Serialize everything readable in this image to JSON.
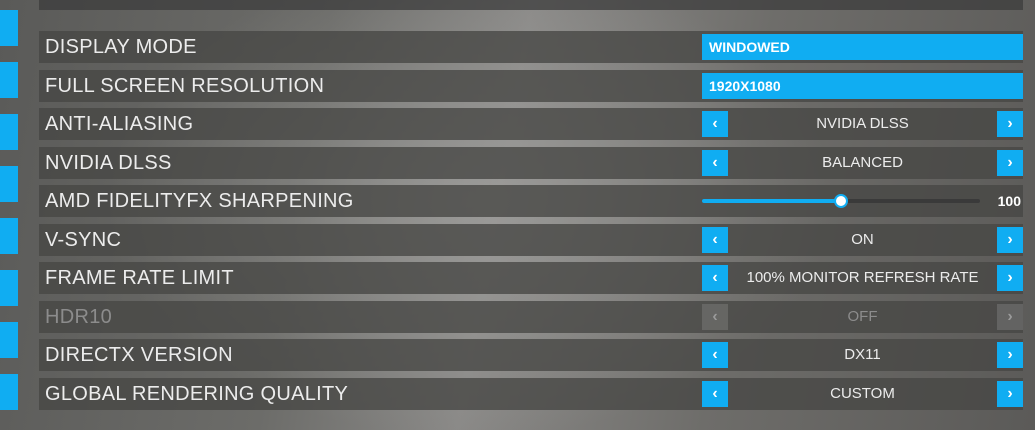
{
  "theme": {
    "accent": "#10adf2",
    "row_background": "#464644"
  },
  "settings": [
    {
      "label": "DISPLAY MODE",
      "control": "dropdown",
      "value": "WINDOWED"
    },
    {
      "label": "FULL SCREEN RESOLUTION",
      "control": "dropdown",
      "value": "1920X1080"
    },
    {
      "label": "ANTI-ALIASING",
      "control": "stepper",
      "value": "NVIDIA DLSS"
    },
    {
      "label": "NVIDIA DLSS",
      "control": "stepper",
      "value": "BALANCED"
    },
    {
      "label": "AMD FIDELITYFX SHARPENING",
      "control": "slider",
      "value": "100",
      "slider_fraction": 0.5
    },
    {
      "label": "V-SYNC",
      "control": "stepper",
      "value": "ON"
    },
    {
      "label": "FRAME RATE LIMIT",
      "control": "stepper",
      "value": "100% MONITOR REFRESH RATE"
    },
    {
      "label": "HDR10",
      "control": "stepper",
      "value": "OFF",
      "disabled": true
    },
    {
      "label": "DIRECTX VERSION",
      "control": "stepper",
      "value": "DX11"
    },
    {
      "label": "GLOBAL RENDERING QUALITY",
      "control": "stepper",
      "value": "CUSTOM"
    }
  ],
  "icons": {
    "previous": "chevron-left-icon",
    "next": "chevron-right-icon"
  }
}
